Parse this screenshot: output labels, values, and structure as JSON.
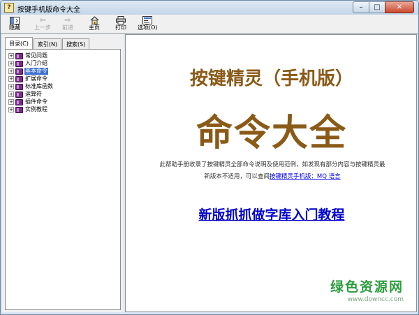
{
  "window": {
    "title": "按键手机版命令大全",
    "icon": "help-book-icon",
    "title_icon_glyph": "?"
  },
  "toolbar": {
    "hide_label": "隐藏",
    "back_label": "上一步",
    "forward_label": "前进",
    "home_label": "主页",
    "print_label": "打印",
    "options_label": "选项(O)"
  },
  "tabs": [
    {
      "label": "目录(C)",
      "active": true
    },
    {
      "label": "索引(N)",
      "active": false
    },
    {
      "label": "搜索(S)",
      "active": false
    }
  ],
  "tree": [
    {
      "label": "常见问题",
      "selected": false
    },
    {
      "label": "入门介绍",
      "selected": false
    },
    {
      "label": "基本命令",
      "selected": true
    },
    {
      "label": "扩展命令",
      "selected": false
    },
    {
      "label": "标准库函数",
      "selected": false
    },
    {
      "label": "运算符",
      "selected": false
    },
    {
      "label": "插件命令",
      "selected": false
    },
    {
      "label": "实例教程",
      "selected": false
    }
  ],
  "content": {
    "heading_small": "按键精灵（手机版）",
    "heading_big": "命令大全",
    "desc_line1": "此帮助手册收录了按键精灵全部命令说明及使用范例，如发现有部分内容与按键精灵最",
    "desc_line2_prefix": "新版本不适用，可以查阅",
    "desc_link": "按键精灵手机版：MQ 语言",
    "big_link": "新版抓抓做字库入门教程"
  },
  "watermark": {
    "main": "绿色资源网",
    "sub": "www.downcc.com"
  },
  "colors": {
    "heading": "#8a5a17",
    "link": "#0000cc",
    "selection": "#3a6fd0",
    "watermark": "#2c9d3e"
  }
}
